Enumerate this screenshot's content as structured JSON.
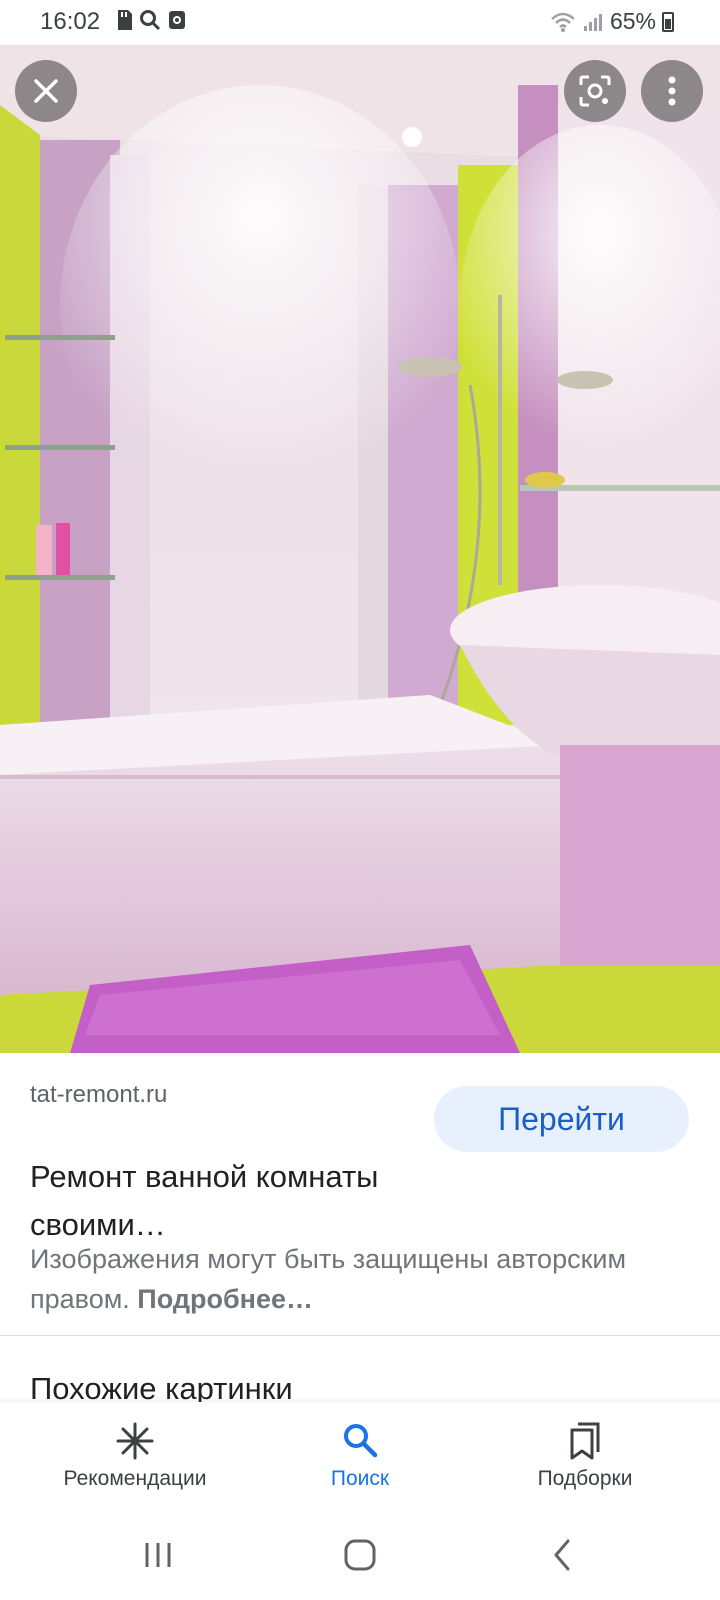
{
  "status_bar": {
    "time": "16:02",
    "battery": "65%"
  },
  "image": {
    "description_icons": [
      "close-icon",
      "lens-icon",
      "more-vert-icon"
    ]
  },
  "result": {
    "domain": "tat-remont.ru",
    "goto_label": "Перейти",
    "title": "Ремонт ванной комнаты своими…",
    "copyright_text": "Изображения могут быть защищены авторским правом.",
    "copyright_more": "Подробнее…",
    "similar_heading": "Похожие картинки"
  },
  "bottom_nav": {
    "items": [
      {
        "label": "Рекомендации",
        "icon": "asterisk-icon"
      },
      {
        "label": "Поиск",
        "icon": "search-icon",
        "active": true
      },
      {
        "label": "Подборки",
        "icon": "collections-icon"
      }
    ]
  },
  "colors": {
    "accent": "#1a73e8",
    "button_bg": "#e8f0fe"
  }
}
